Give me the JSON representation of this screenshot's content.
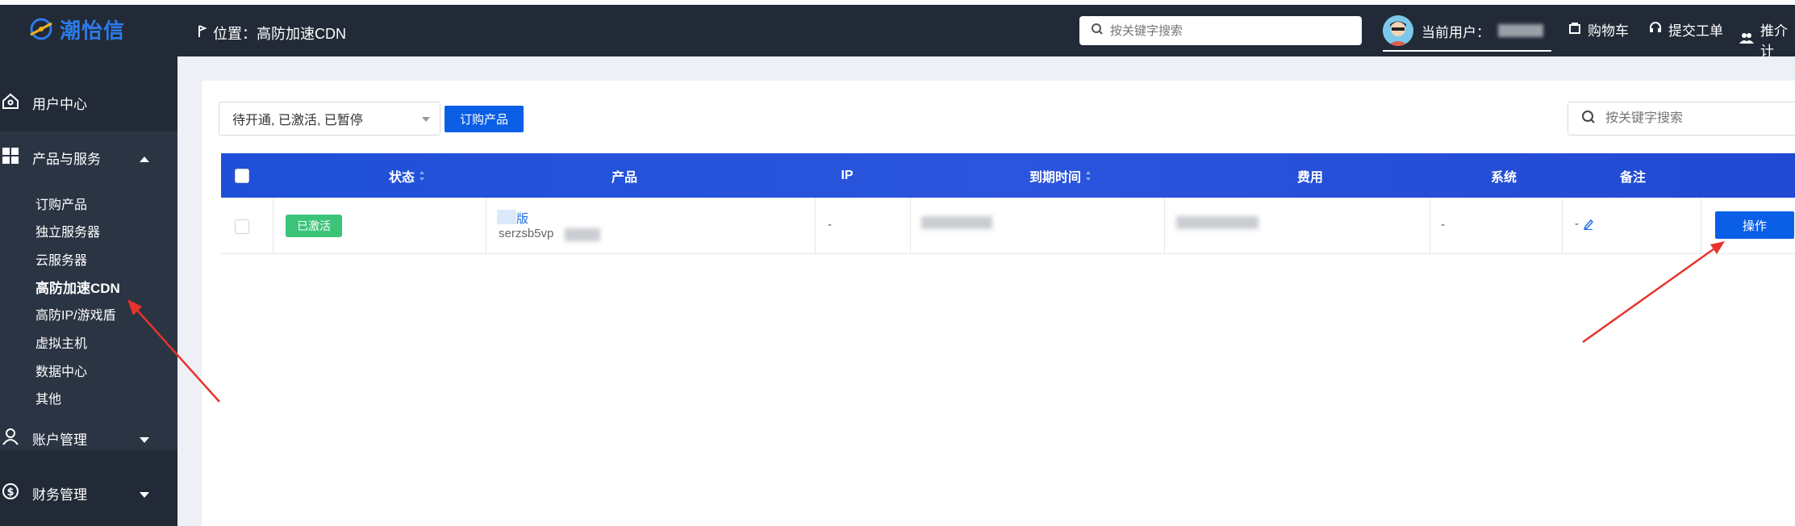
{
  "brand": {
    "logo_text": "潮怡信"
  },
  "header": {
    "location": "位置：高防加速CDN",
    "search_placeholder": "按关键字搜索",
    "user_label": "当前用户：",
    "links": [
      "购物车",
      "提交工单",
      "推介计"
    ]
  },
  "sidebar": {
    "groups": [
      {
        "label": "用户中心",
        "icon": "home-icon"
      },
      {
        "label": "产品与服务",
        "icon": "grid-icon"
      },
      {
        "label": "账户管理",
        "icon": "user-icon"
      },
      {
        "label": "财务管理",
        "icon": "dollar-icon"
      }
    ],
    "sub_items": [
      "订购产品",
      "独立服务器",
      "云服务器",
      "高防加速CDN",
      "高防IP/游戏盾",
      "虚拟主机",
      "数据中心",
      "其他"
    ],
    "active_item": "高防加速CDN"
  },
  "toolbar": {
    "filter_value": "待开通, 已激活, 已暂停",
    "order_button": "订购产品",
    "search_placeholder": "按关键字搜索"
  },
  "table": {
    "columns": [
      "状态",
      "产品",
      "IP",
      "到期时间",
      "费用",
      "系统",
      "备注"
    ],
    "rows": [
      {
        "status": "已激活",
        "product_name": "版",
        "product_id": "serzsb5vp",
        "ip": "-",
        "system": "-",
        "note": "-",
        "action": "操作"
      }
    ]
  },
  "colors": {
    "sidebar_bg": "#222a37",
    "header_gradient": "#2b55dd",
    "primary_button": "#0a5fe6",
    "status_active": "#3cc37a",
    "annotation_arrow": "#e8332c"
  }
}
